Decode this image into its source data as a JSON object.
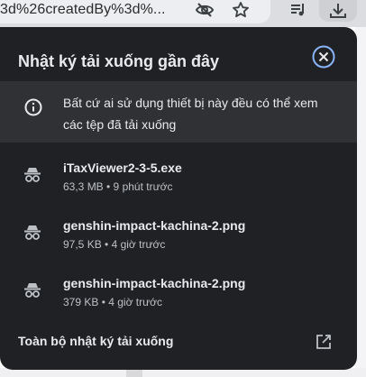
{
  "toolbar": {
    "url_fragment": "3d%26createdBy%3d%...",
    "icons": [
      "eye-off-icon",
      "star-icon",
      "playlist-icon",
      "download-icon"
    ]
  },
  "downloads": {
    "title": "Nhật ký tải xuống gần đây",
    "close_icon": "close-icon",
    "notice": {
      "icon": "info-icon",
      "text": "Bất cứ ai sử dụng thiết bị này đều có thể xem các tệp đã tải xuống"
    },
    "items": [
      {
        "icon": "incognito-icon",
        "name": "iTaxViewer2-3-5.exe",
        "meta": "63,3 MB • 9 phút trước"
      },
      {
        "icon": "incognito-icon",
        "name": "genshin-impact-kachina-2.png",
        "meta": "97,5 KB • 4 giờ trước"
      },
      {
        "icon": "incognito-icon",
        "name": "genshin-impact-kachina-2.png",
        "meta": "379 KB • 4 giờ trước"
      }
    ],
    "footer": {
      "label": "Toàn bộ nhật ký tải xuống",
      "icon": "open-external-icon"
    }
  },
  "colors": {
    "bubble_bg": "#202124",
    "notice_bg": "#303134",
    "text_primary": "#e8eaed",
    "text_secondary": "#bdc1c6",
    "close_ring": "#8ab4f8"
  }
}
